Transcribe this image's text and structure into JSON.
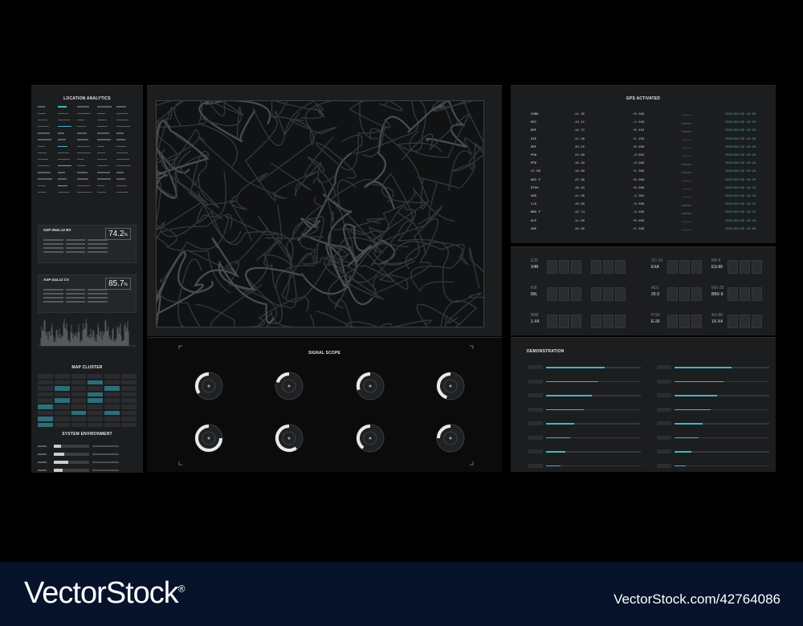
{
  "left": {
    "location_title": "LOCATION ANALYTICS",
    "card1": {
      "title": "GZP-2641.12 BV",
      "value": "74.2",
      "unit": "%"
    },
    "card2": {
      "title": "AXP-244.12 CV",
      "value": "85.7",
      "unit": "%"
    },
    "cluster_title": "MAP CLUSTER",
    "env_title": "SYSTEM ENVIRONMENT"
  },
  "scope": {
    "title": "SIGNAL SCOPE",
    "gauge_fill": [
      0.35,
      0.2,
      0.3,
      0.45,
      0.75,
      0.6,
      0.4,
      0.25
    ]
  },
  "gps": {
    "title": "GPS ACTIVATED",
    "rows": [
      {
        "code": "CHNK",
        "a": "11.35",
        "b": "+0.026",
        "t": "2023/03/28 16:36"
      },
      {
        "code": "KEI",
        "a": "13.11",
        "b": "-1.043",
        "t": "2023/03/28 16:34"
      },
      {
        "code": "BGF",
        "a": "14.72",
        "b": "+0.152",
        "t": "2023/03/28 16:33"
      },
      {
        "code": "AIE",
        "a": "11.36",
        "b": "+1.253",
        "t": "2023/03/28 16:30"
      },
      {
        "code": "DDF",
        "a": "20.15",
        "b": "+0.956",
        "t": "2023/03/28 16:28"
      },
      {
        "code": "POA",
        "a": "24.09",
        "b": "-0.652",
        "t": "2023/03/28 16:26"
      },
      {
        "code": "PPD",
        "a": "18.26",
        "b": "-0.996",
        "t": "2023/03/28 16:24"
      },
      {
        "code": "LF.DA",
        "a": "16.86",
        "b": "+1.365",
        "t": "2023/03/28 16:22"
      },
      {
        "code": "ADI.F",
        "a": "22.36",
        "b": "+0.956",
        "t": "2023/03/28 16:20"
      },
      {
        "code": "DTEK",
        "a": "18.43",
        "b": "+0.886",
        "t": "2023/03/28 16:18"
      },
      {
        "code": "ASD",
        "a": "11.36",
        "b": "-1.362",
        "t": "2023/03/28 16:16"
      },
      {
        "code": "LLD",
        "a": "15.89",
        "b": "-0.886",
        "t": "2023/03/28 16:14"
      },
      {
        "code": "BBX.F",
        "a": "12.74",
        "b": "-0.485",
        "t": "2023/03/28 16:12"
      },
      {
        "code": "KLP",
        "a": "11.89",
        "b": "+0.656",
        "t": "2023/03/28 16:10"
      },
      {
        "code": "ASE",
        "a": "29.36",
        "b": "+1.336",
        "t": "2023/03/28 16:08"
      }
    ]
  },
  "chips": [
    {
      "a": "E29",
      "b": "X4B"
    },
    {
      "a": "",
      "b": ""
    },
    {
      "a": "XC-19",
      "b": "EXA"
    },
    {
      "a": "BB-8",
      "b": "ES-89"
    },
    {
      "a": "KI8",
      "b": "89L"
    },
    {
      "a": "",
      "b": ""
    },
    {
      "a": "ADJ",
      "b": "26-3"
    },
    {
      "a": "WX-29",
      "b": "BBX-9"
    },
    {
      "a": "BB8",
      "b": "1-X4"
    },
    {
      "a": "",
      "b": ""
    },
    {
      "a": "POA",
      "b": "E-26"
    },
    {
      "a": "AX-88",
      "b": "1X-X4"
    }
  ],
  "demo": {
    "title": "DEMONSTRATION",
    "left_levels": [
      0.62,
      0.55,
      0.48,
      0.4,
      0.3,
      0.25,
      0.2,
      0.15
    ],
    "right_levels": [
      0.6,
      0.52,
      0.45,
      0.38,
      0.3,
      0.25,
      0.18,
      0.12
    ]
  },
  "footer": {
    "brand": "VectorStock",
    "reg": "®",
    "id": "VectorStock.com/42764086"
  }
}
